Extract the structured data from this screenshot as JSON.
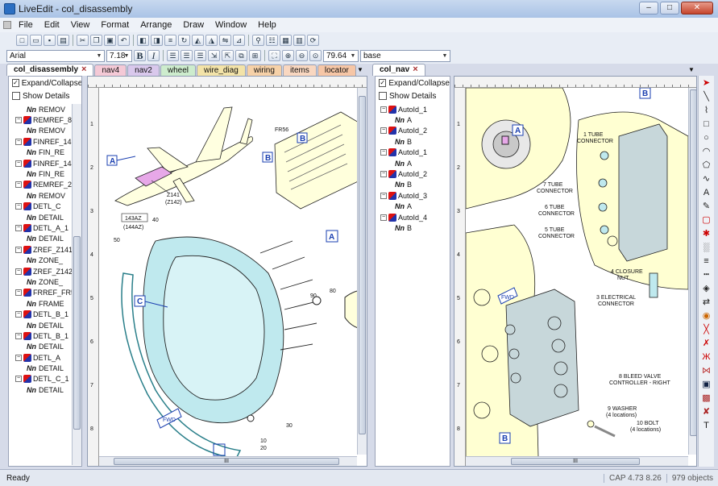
{
  "window": {
    "title": "LiveEdit - col_disassembly",
    "minimize": "–",
    "maximize": "□",
    "close": "✕"
  },
  "menu": [
    "File",
    "Edit",
    "View",
    "Format",
    "Arrange",
    "Draw",
    "Window",
    "Help"
  ],
  "format_bar": {
    "font": "Arial",
    "size": "7.18",
    "zoom": "79.64",
    "layer": "base"
  },
  "left_tabs": [
    {
      "label": "col_disassembly",
      "color": "#ffffff"
    },
    {
      "label": "nav4",
      "color": "#f4c9d6"
    },
    {
      "label": "nav2",
      "color": "#d9c8ec"
    },
    {
      "label": "wheel",
      "color": "#cdeccd"
    },
    {
      "label": "wire_diag",
      "color": "#f3e3a8"
    },
    {
      "label": "wiring",
      "color": "#f6d1a8"
    },
    {
      "label": "items",
      "color": "#f9d7c0"
    },
    {
      "label": "locator",
      "color": "#f6c6a6"
    }
  ],
  "right_tabs": [
    {
      "label": "col_nav",
      "color": "#ffffff"
    }
  ],
  "left_tree": {
    "expand_label": "Expand/Collapse",
    "details_label": "Show Details",
    "expand_checked": true,
    "nodes": [
      {
        "kind": "nn",
        "text": "REMOV"
      },
      {
        "kind": "obj",
        "text": "REMREF_8"
      },
      {
        "kind": "nn",
        "text": "REMOV"
      },
      {
        "kind": "obj",
        "text": "FINREF_143"
      },
      {
        "kind": "nn",
        "text": "FIN_RE"
      },
      {
        "kind": "obj",
        "text": "FINREF_144"
      },
      {
        "kind": "nn",
        "text": "FIN_RE"
      },
      {
        "kind": "obj",
        "text": "REMREF_2"
      },
      {
        "kind": "nn",
        "text": "REMOV"
      },
      {
        "kind": "obj",
        "text": "DETL_C"
      },
      {
        "kind": "nn",
        "text": "DETAIL"
      },
      {
        "kind": "obj",
        "text": "DETL_A_1"
      },
      {
        "kind": "nn",
        "text": "DETAIL"
      },
      {
        "kind": "obj",
        "text": "ZREF_Z141"
      },
      {
        "kind": "nn",
        "text": "ZONE_"
      },
      {
        "kind": "obj",
        "text": "ZREF_Z142"
      },
      {
        "kind": "nn",
        "text": "ZONE_"
      },
      {
        "kind": "obj",
        "text": "FRREF_FR5"
      },
      {
        "kind": "nn",
        "text": "FRAME"
      },
      {
        "kind": "obj",
        "text": "DETL_B_1"
      },
      {
        "kind": "nn",
        "text": "DETAIL"
      },
      {
        "kind": "obj",
        "text": "DETL_B_1"
      },
      {
        "kind": "nn",
        "text": "DETAIL"
      },
      {
        "kind": "obj",
        "text": "DETL_A"
      },
      {
        "kind": "nn",
        "text": "DETAIL"
      },
      {
        "kind": "obj",
        "text": "DETL_C_1"
      },
      {
        "kind": "nn",
        "text": "DETAIL"
      }
    ]
  },
  "right_tree": {
    "expand_label": "Expand/Collapse",
    "details_label": "Show Details",
    "expand_checked": true,
    "nodes": [
      {
        "kind": "obj",
        "text": "AutoId_1"
      },
      {
        "kind": "nn",
        "text": "A"
      },
      {
        "kind": "obj",
        "text": "AutoId_2"
      },
      {
        "kind": "nn",
        "text": "B"
      },
      {
        "kind": "obj",
        "text": "AutoId_1"
      },
      {
        "kind": "nn",
        "text": "A"
      },
      {
        "kind": "obj",
        "text": "AutoId_2"
      },
      {
        "kind": "nn",
        "text": "B"
      },
      {
        "kind": "obj",
        "text": "AutoId_3"
      },
      {
        "kind": "nn",
        "text": "A"
      },
      {
        "kind": "obj",
        "text": "AutoId_4"
      },
      {
        "kind": "nn",
        "text": "B"
      }
    ]
  },
  "left_drawing": {
    "callouts": [
      "A",
      "B",
      "B",
      "A",
      "C"
    ],
    "labels": {
      "fr56": "FR56",
      "z141": "Z141",
      "z142": "(Z142)",
      "az143": "143AZ",
      "az144": "(144AZ)",
      "n40": "40",
      "n50": "50",
      "n80": "80",
      "n90": "90",
      "n30": "30",
      "n10": "10",
      "n20": "20",
      "fwd": "FWD"
    },
    "ruler": [
      "1",
      "2",
      "3",
      "4",
      "5",
      "6",
      "7",
      "8"
    ]
  },
  "right_drawing": {
    "callouts": [
      "A",
      "B",
      "B"
    ],
    "labels": {
      "l1": "1 TUBE",
      "l1b": "CONNECTOR",
      "l7": "7 TUBE",
      "l7b": "CONNECTOR",
      "l6": "6 TUBE",
      "l6b": "CONNECTOR",
      "l5": "5 TUBE",
      "l5b": "CONNECTOR",
      "l4": "4 CLOSURE",
      "l4b": "NUT",
      "l3": "3 ELECTRICAL",
      "l3b": "CONNECTOR",
      "l8": "8 BLEED VALVE",
      "l8b": "CONTROLLER - RIGHT",
      "l9": "9 WASHER",
      "l9b": "(4 locations)",
      "l10": "10 BOLT",
      "l10b": "(4 locations)",
      "fwd": "FWD"
    },
    "ruler": [
      "1",
      "2",
      "3",
      "4",
      "5",
      "6",
      "7",
      "8"
    ]
  },
  "scroll_grip": "III",
  "status": {
    "ready": "Ready",
    "cap": "CAP 4.73 8.26",
    "objects": "979 objects"
  },
  "colors": {
    "accent": "#1a3fb0",
    "part_fill": "#bfe9ee",
    "highlight": "#ffffcc"
  }
}
